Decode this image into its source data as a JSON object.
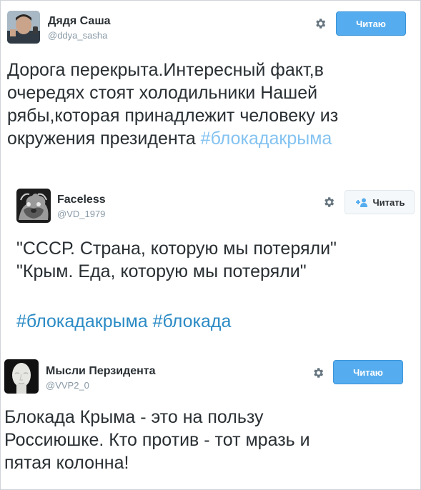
{
  "tweets": [
    {
      "author": "Дядя Саша",
      "handle": "@ddya_sasha",
      "button_label": "Читаю",
      "lines": [
        "Дорога перекрыта.Интересный факт,в",
        "очередях стоят холодильники Нашей",
        "рябы,которая принадлежит человеку из",
        "окружения президента "
      ],
      "hashtag": "#блокадакрыма"
    },
    {
      "author": "Faceless",
      "handle": "@VD_1979",
      "button_label": "Читать",
      "lines": [
        "\"СССР. Страна, которую мы потеряли\"",
        "\"Крым. Еда, которую мы потеряли\""
      ],
      "hashtags": [
        "#блокадакрыма",
        "#блокада"
      ]
    },
    {
      "author": "Мысли Перзидента",
      "handle": "@VVP2_0",
      "button_label": "Читаю",
      "lines": [
        "Блокада Крыма - это на пользу",
        "Россиюшке. Кто против - тот мразь и",
        "пятая колонна!"
      ]
    }
  ],
  "colors": {
    "following_button": "#55acee",
    "hashtag": "#84c3f1",
    "handle": "#8899a6",
    "text": "#292f33"
  },
  "icons": [
    "gear-icon",
    "follow-plus-icon"
  ]
}
